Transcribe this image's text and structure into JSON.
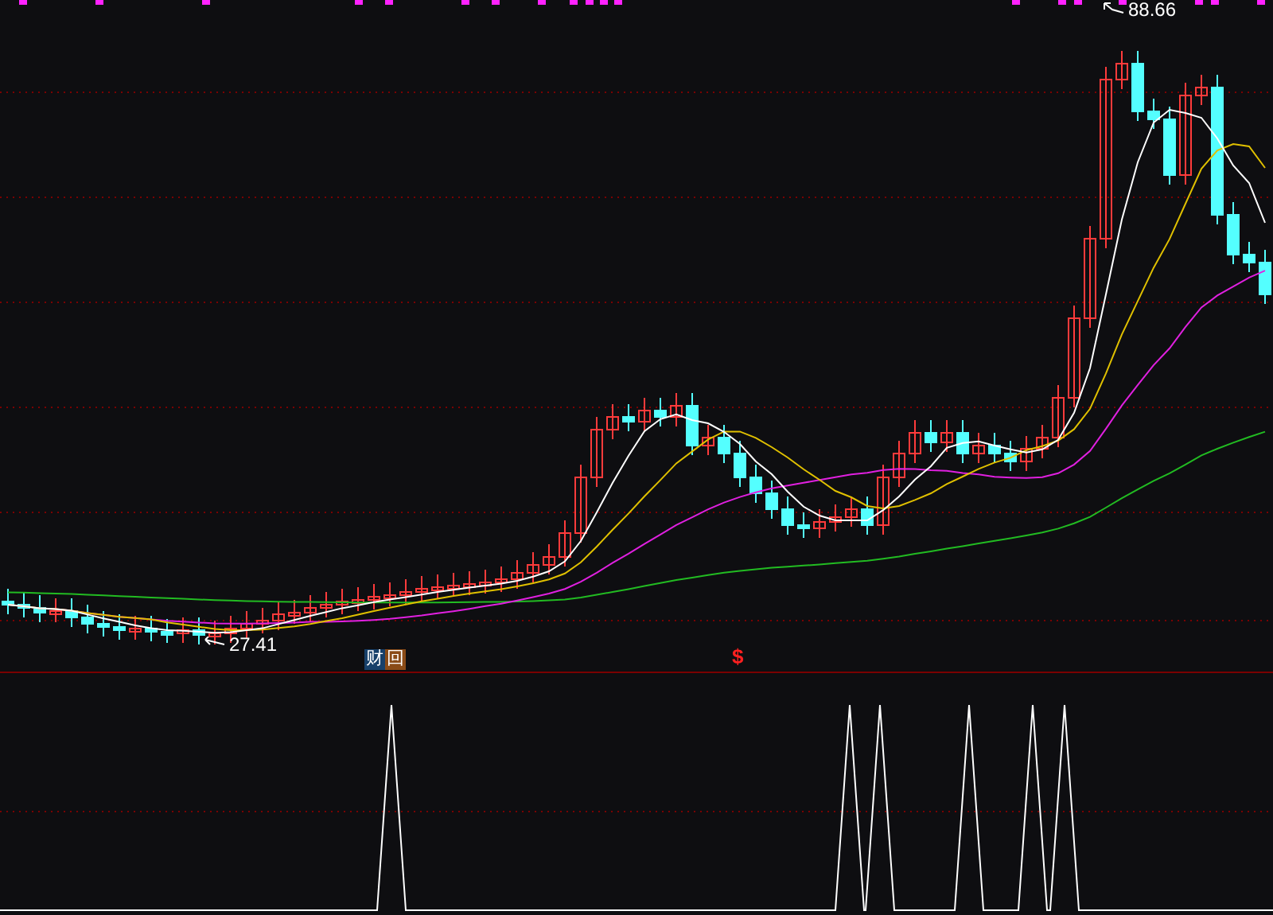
{
  "price_chart": {
    "high_label": "88.66",
    "low_label": "27.41",
    "tags": [
      {
        "text": "财",
        "color": "#17406a"
      },
      {
        "text": "回",
        "color": "#8a4b17"
      }
    ],
    "signal_mark": "$"
  }
}
